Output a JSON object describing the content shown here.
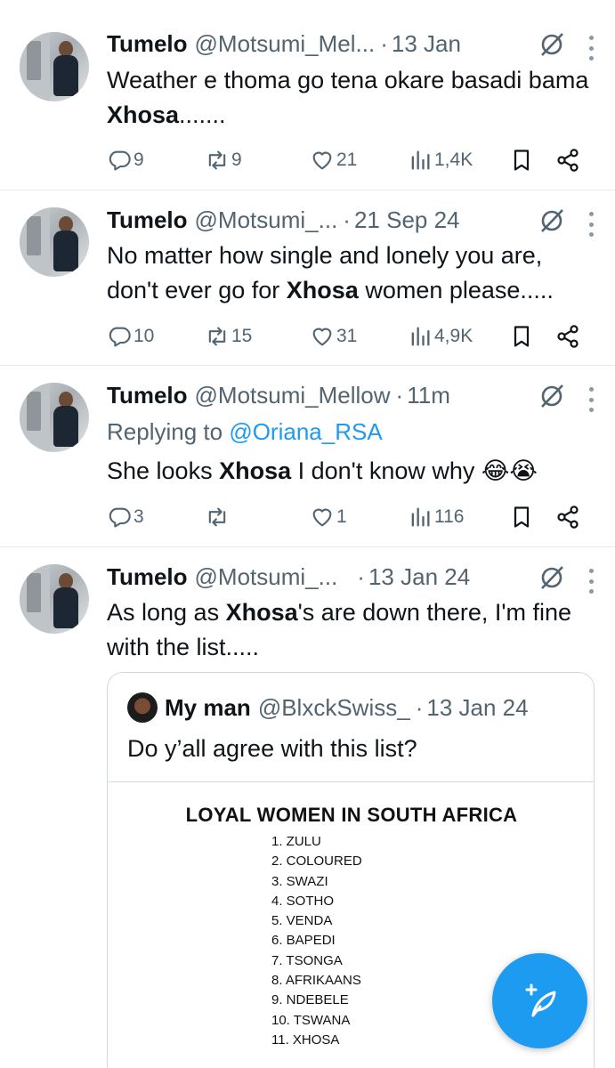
{
  "tweets": [
    {
      "name": "Tumelo",
      "handle": "@Motsumi_Mel...",
      "date": "13 Jan",
      "text_before": "Weather e thoma go tena okare basadi bama ",
      "bold": "Xhosa",
      "text_after": ".......",
      "replies": "9",
      "retweets": "9",
      "likes": "21",
      "views": "1,4K"
    },
    {
      "name": "Tumelo",
      "handle": "@Motsumi_...",
      "date": "21 Sep 24",
      "text_before": "No matter how single and lonely you are, don't ever go for ",
      "bold": "Xhosa",
      "text_after": " women please.....",
      "replies": "10",
      "retweets": "15",
      "likes": "31",
      "views": "4,9K"
    },
    {
      "name": "Tumelo",
      "handle": "@Motsumi_Mellow",
      "date": "11m",
      "replying_prefix": "Replying to",
      "replying_to": "@Oriana_RSA",
      "text_before": "She looks ",
      "bold": "Xhosa",
      "text_after": " I don't know why 😂😭",
      "replies": "3",
      "retweets": "",
      "likes": "1",
      "views": "116"
    },
    {
      "name": "Tumelo",
      "handle": "@Motsumi_...",
      "date": "13 Jan 24",
      "text_before": "As long as ",
      "bold": "Xhosa",
      "text_after": "'s are down there, I'm fine with the list.....",
      "quote": {
        "name": "My man",
        "handle": "@BlxckSwiss_",
        "date": "13 Jan 24",
        "text": "Do y’all agree with this list?",
        "image_title": "LOYAL WOMEN IN SOUTH AFRICA",
        "image_list": [
          "1. ZULU",
          "2. COLOURED",
          "3. SWAZI",
          "4. SOTHO",
          "5. VENDA",
          "6. BAPEDI",
          "7. TSONGA",
          "8. AFRIKAANS",
          "9. NDEBELE",
          "10.  TSWANA",
          "11.  XHOSA"
        ]
      }
    }
  ],
  "separator": "·",
  "icons": {
    "reply": "reply-icon",
    "retweet": "retweet-icon",
    "like": "heart-icon",
    "views": "views-icon",
    "bookmark": "bookmark-icon",
    "share": "share-icon",
    "grok": "grok-icon",
    "more": "more-icon",
    "compose": "compose-icon"
  },
  "colors": {
    "accent": "#1d9bf0",
    "text": "#0f1419",
    "secondary": "#536471",
    "border": "#e6ecf0"
  }
}
